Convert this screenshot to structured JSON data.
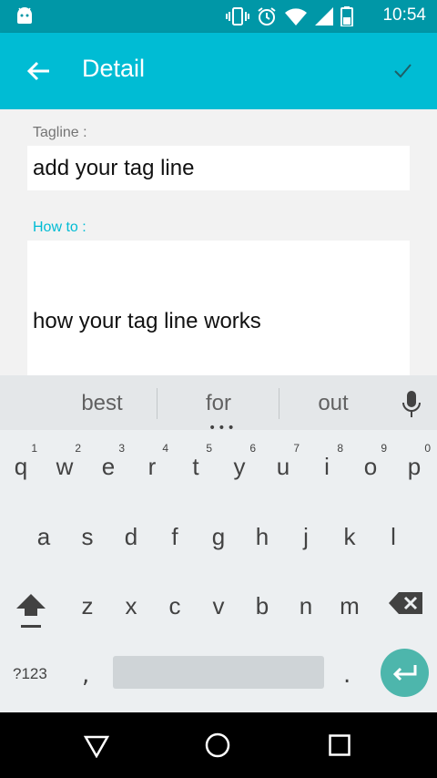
{
  "status_bar": {
    "time": "10:54"
  },
  "app_bar": {
    "title": "Detail"
  },
  "form": {
    "tagline_label": "Tagline :",
    "tagline_value": "add your tag line",
    "howto_label": "How to :",
    "howto_value": "how your tag line works"
  },
  "keyboard": {
    "suggestions": [
      "best",
      "for",
      "out"
    ],
    "row1": [
      {
        "key": "q",
        "hint": "1"
      },
      {
        "key": "w",
        "hint": "2"
      },
      {
        "key": "e",
        "hint": "3"
      },
      {
        "key": "r",
        "hint": "4"
      },
      {
        "key": "t",
        "hint": "5"
      },
      {
        "key": "y",
        "hint": "6"
      },
      {
        "key": "u",
        "hint": "7"
      },
      {
        "key": "i",
        "hint": "8"
      },
      {
        "key": "o",
        "hint": "9"
      },
      {
        "key": "p",
        "hint": "0"
      }
    ],
    "row2": [
      "a",
      "s",
      "d",
      "f",
      "g",
      "h",
      "j",
      "k",
      "l"
    ],
    "row3": [
      "z",
      "x",
      "c",
      "v",
      "b",
      "n",
      "m"
    ],
    "symbols_label": "?123",
    "comma": ",",
    "period": "."
  },
  "colors": {
    "accent": "#00bcd4",
    "status_bar": "#0097a7",
    "enter_key": "#4db6ac"
  },
  "icons": [
    "android-icon",
    "vibrate-icon",
    "alarm-icon",
    "wifi-icon",
    "signal-icon",
    "battery-icon",
    "back-arrow-icon",
    "check-icon",
    "mic-icon",
    "shift-icon",
    "delete-icon",
    "enter-icon",
    "nav-back-icon",
    "nav-home-icon",
    "nav-recents-icon"
  ]
}
